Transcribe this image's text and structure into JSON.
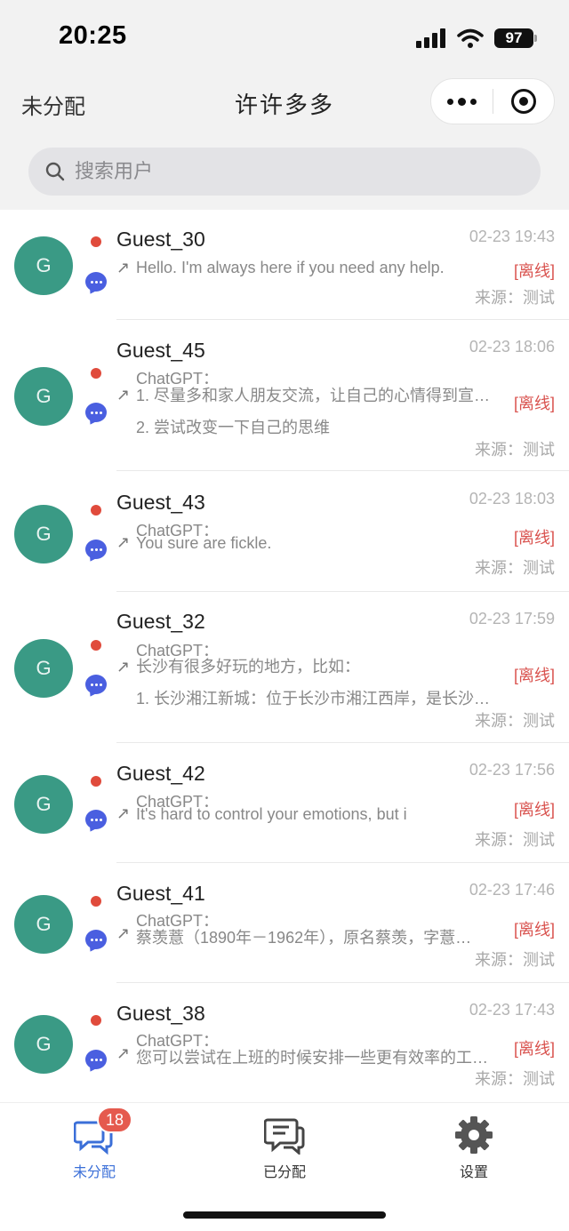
{
  "status_bar": {
    "time": "20:25",
    "battery": "97"
  },
  "nav": {
    "left": "未分配",
    "title": "许许多多"
  },
  "search": {
    "placeholder": "搜索用户"
  },
  "conversations": [
    {
      "avatar": "G",
      "name": "Guest_30",
      "time": "02-23 19:43",
      "status": "[离线]",
      "source": "来源：测试",
      "lines": [
        "Hello. I'm always here if you need any help."
      ]
    },
    {
      "avatar": "G",
      "name": "Guest_45",
      "time": "02-23 18:06",
      "status": "[离线]",
      "source": "来源：测试",
      "lines": [
        "ChatGPT：",
        "1. 尽量多和家人朋友交流，让自己的心情得到宣…",
        "2. 尝试改变一下自己的思维"
      ]
    },
    {
      "avatar": "G",
      "name": "Guest_43",
      "time": "02-23 18:03",
      "status": "[离线]",
      "source": "来源：测试",
      "lines": [
        "ChatGPT：",
        "You sure are fickle."
      ]
    },
    {
      "avatar": "G",
      "name": "Guest_32",
      "time": "02-23 17:59",
      "status": "[离线]",
      "source": "来源：测试",
      "lines": [
        "ChatGPT：",
        "长沙有很多好玩的地方，比如：",
        "1. 长沙湘江新城：位于长沙市湘江西岸，是长沙…"
      ]
    },
    {
      "avatar": "G",
      "name": "Guest_42",
      "time": "02-23 17:56",
      "status": "[离线]",
      "source": "来源：测试",
      "lines": [
        "ChatGPT：",
        "It's hard to control your emotions, but i"
      ]
    },
    {
      "avatar": "G",
      "name": "Guest_41",
      "time": "02-23 17:46",
      "status": "[离线]",
      "source": "来源：测试",
      "lines": [
        "ChatGPT：",
        "蔡羡薏（1890年－1962年），原名蔡羡，字薏…"
      ]
    },
    {
      "avatar": "G",
      "name": "Guest_38",
      "time": "02-23 17:43",
      "status": "[离线]",
      "source": "来源：测试",
      "lines": [
        "ChatGPT：",
        "您可以尝试在上班的时候安排一些更有效率的工…"
      ]
    }
  ],
  "tabbar": {
    "unassigned": {
      "label": "未分配",
      "badge": "18"
    },
    "assigned": {
      "label": "已分配"
    },
    "settings": {
      "label": "设置"
    }
  },
  "colors": {
    "accent": "#3b6fd8",
    "avatar": "#3a9a85",
    "offline": "#d9534f",
    "unread_dot": "#e04b3c",
    "badge": "#e55a4e"
  }
}
